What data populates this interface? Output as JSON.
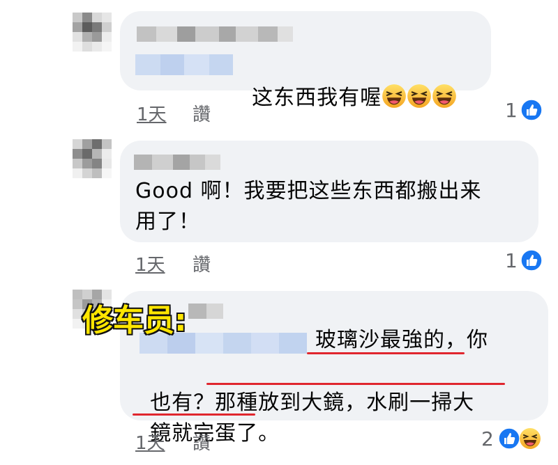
{
  "comments": [
    {
      "text": "这东西我有喔",
      "emojis": [
        "haha-icon",
        "haha-icon",
        "haha-icon"
      ],
      "time": "1天",
      "like_action": "讚",
      "reaction_count": "1"
    },
    {
      "text_line1": "Good 啊！我要把这些东西都搬出来",
      "text_line2": "用了！",
      "time": "1天",
      "like_action": "讚",
      "reaction_count": "1"
    },
    {
      "overlay_tag": "修车员:",
      "text_line1": "玻璃沙最強的，你",
      "text_line2_a": "也有？",
      "text_line2_b": "那種放到大鏡，水刷一掃大",
      "text_line3_a": "鏡就完蛋了",
      "text_line3_b": "。",
      "time": "1天",
      "like_action": "讚",
      "reaction_count": "2"
    }
  ],
  "colors": {
    "bubble": "#f0f2f5",
    "like_blue": "#1877f2",
    "underline_red": "#e0262e",
    "tag_yellow": "#ffe600"
  }
}
